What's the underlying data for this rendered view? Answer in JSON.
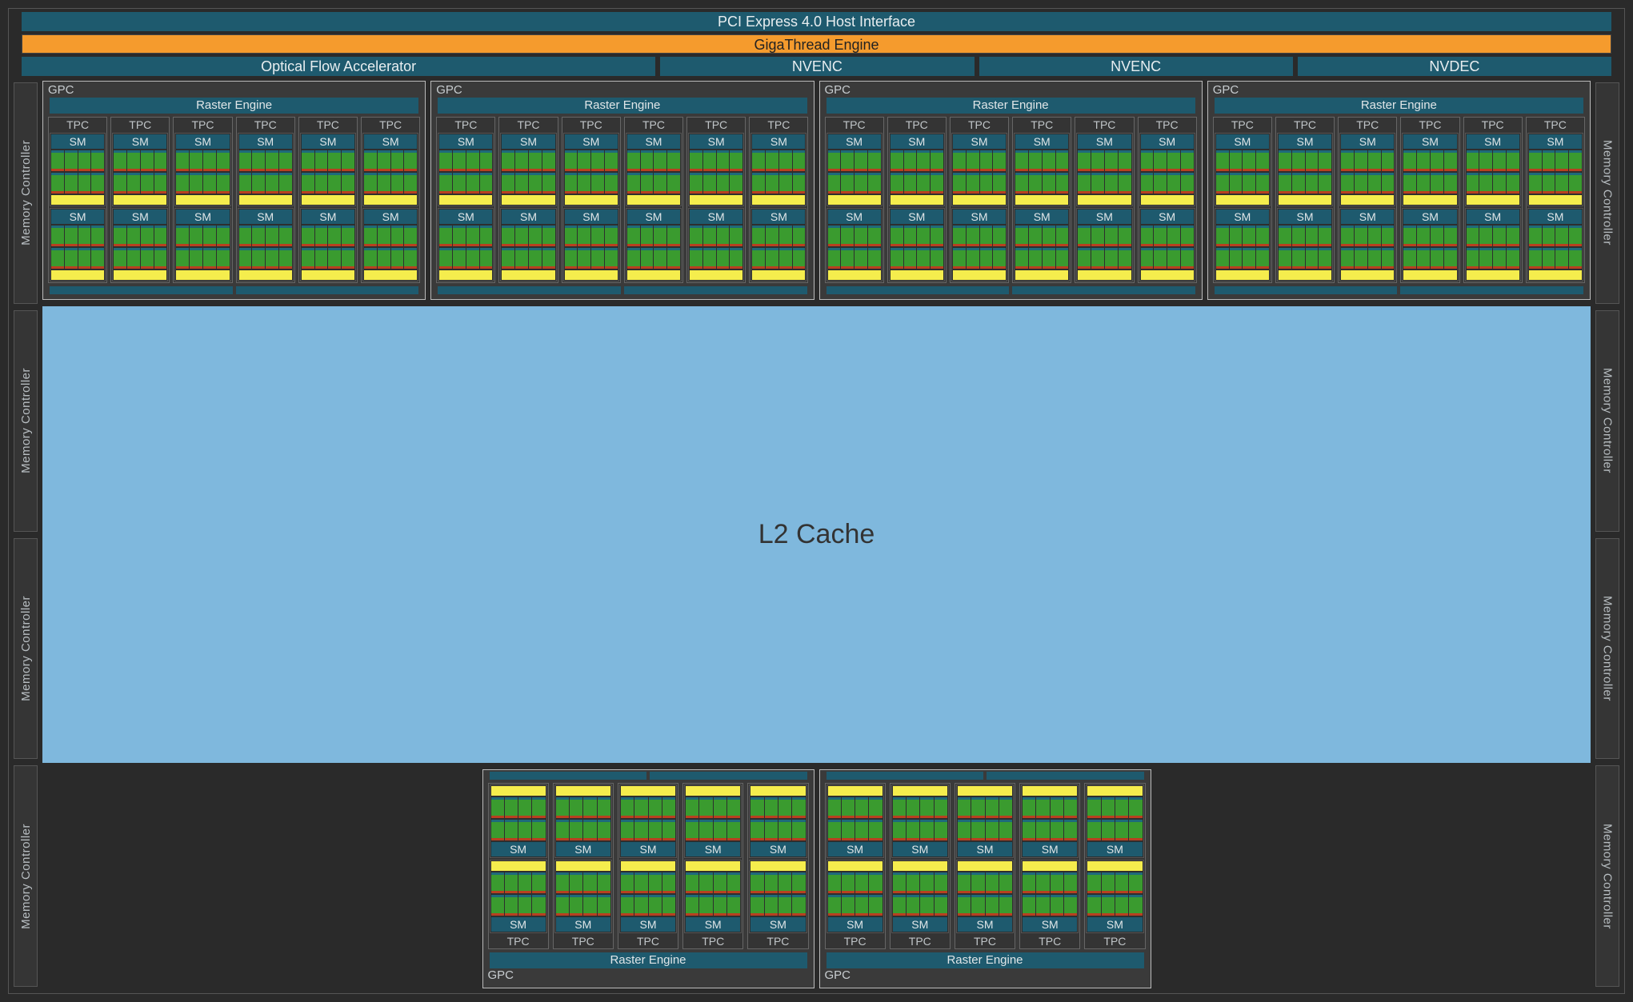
{
  "top": {
    "pcie": "PCI Express 4.0 Host Interface",
    "gigathread": "GigaThread Engine",
    "ofa": "Optical Flow Accelerator",
    "nvenc": "NVENC",
    "nvdec": "NVDEC"
  },
  "gpc_label": "GPC",
  "raster_label": "Raster Engine",
  "tpc_label": "TPC",
  "sm_label": "SM",
  "l2_label": "L2 Cache",
  "mc_label": "Memory Controller",
  "layout": {
    "top_gpc_count": 4,
    "bottom_gpc_count": 2,
    "tpc_per_top_gpc": 6,
    "tpc_per_bottom_gpc": 5,
    "sm_per_tpc": 2,
    "mc_per_side": 4,
    "core_columns_per_sm": 4,
    "core_block_rows_per_sm": 2
  }
}
